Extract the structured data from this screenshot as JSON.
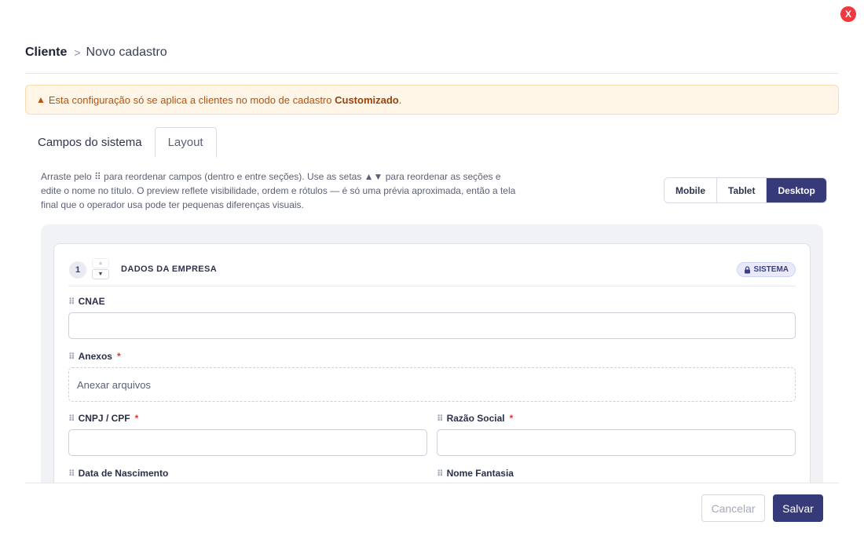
{
  "close": {
    "label": "X"
  },
  "breadcrumb": {
    "root": "Cliente",
    "separator": ">",
    "current": "Novo cadastro"
  },
  "alert": {
    "text_before": "Esta configuração só se aplica a clientes no modo de cadastro ",
    "emphasis": "Customizado",
    "text_after": ".",
    "icon": "warning-triangle-icon"
  },
  "tabs": [
    {
      "label": "Campos do sistema",
      "active": false
    },
    {
      "label": "Layout",
      "active": true
    }
  ],
  "help": {
    "text": "Arraste pelo ⠿ para reordenar campos (dentro e entre seções). Use as setas ▲▼ para reordenar as seções e edite o nome no título. O preview reflete visibilidade, ordem e rótulos — é só uma prévia aproximada, então a tela final que o operador usa pode ter pequenas diferenças visuais."
  },
  "devices": [
    {
      "label": "Mobile",
      "active": false
    },
    {
      "label": "Tablet",
      "active": false
    },
    {
      "label": "Desktop",
      "active": true
    }
  ],
  "section": {
    "number": "1",
    "title": "DADOS DA EMPRESA",
    "badge": "SISTEMA",
    "up_arrow": "▲",
    "down_arrow": "▼"
  },
  "fields": {
    "cnae": {
      "label": "CNAE",
      "required": false
    },
    "anexos": {
      "label": "Anexos",
      "required": true,
      "placeholder": "Anexar arquivos"
    },
    "cnpj": {
      "label": "CNPJ / CPF",
      "required": true
    },
    "razao": {
      "label": "Razão Social",
      "required": true
    },
    "nascimento": {
      "label": "Data de Nascimento",
      "required": false
    },
    "fantasia": {
      "label": "Nome Fantasia",
      "required": false
    },
    "drag_glyph": "⠿",
    "required_mark": "*"
  },
  "footer": {
    "cancel": "Cancelar",
    "save": "Salvar"
  },
  "colors": {
    "primary": "#363a78",
    "danger": "#f0393e",
    "warning_bg": "#fff6e8",
    "warning_text": "#b4530e"
  }
}
